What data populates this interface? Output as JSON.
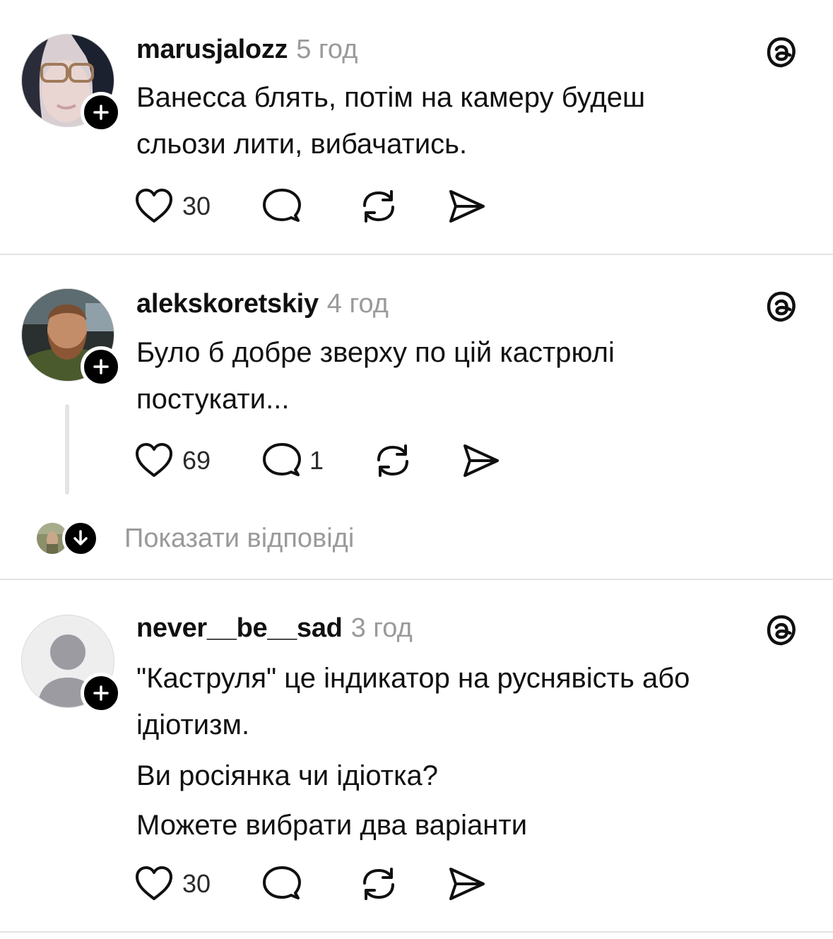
{
  "posts": [
    {
      "username": "marusjalozz",
      "time": "5 год",
      "lines": [
        "Ванесса блять, потім на камеру будеш",
        "сльози лити, вибачатись."
      ],
      "likes": "30",
      "replies": ""
    },
    {
      "username": "alekskoretskiy",
      "time": "4 год",
      "lines": [
        "Було б добре зверху по цій кастрюлі",
        "постукати..."
      ],
      "likes": "69",
      "replies": "1"
    },
    {
      "username": "never__be__sad",
      "time": "3 год",
      "lines": [
        "\"Каструля\" це індикатор на руснявість або",
        "ідіотизм."
      ],
      "extra_lines": [
        "Ви росіянка чи ідіотка?",
        "Можете вибрати два варіанти"
      ],
      "likes": "30",
      "replies": ""
    }
  ],
  "show_replies_label": "Показати відповіді",
  "icons": {
    "like": "heart-icon",
    "reply": "comment-icon",
    "repost": "repost-icon",
    "share": "share-icon",
    "follow": "plus-icon",
    "app": "threads-icon",
    "expand": "arrow-down-icon"
  },
  "colors": {
    "text": "#101010",
    "muted": "#9a9a9a",
    "divider": "#e3e3e3",
    "badge": "#000000"
  }
}
